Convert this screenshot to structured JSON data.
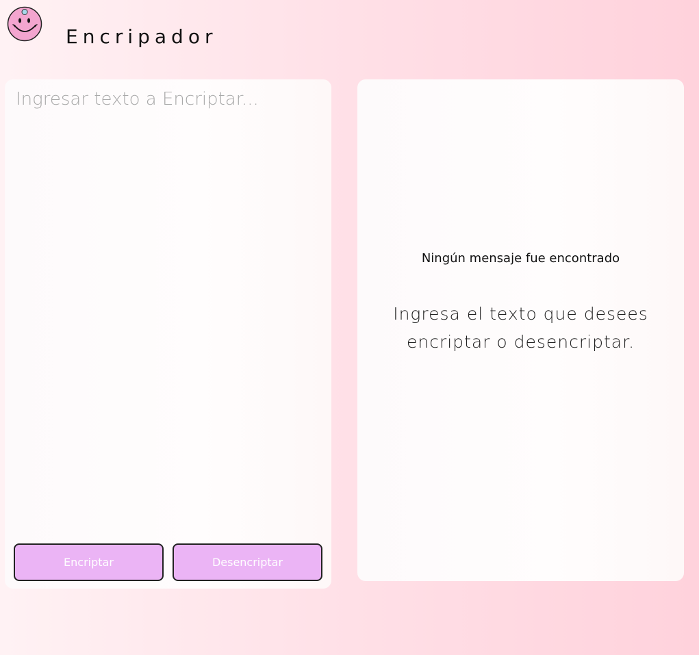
{
  "header": {
    "title": "Encripador",
    "logo_icon": "smiley-face-icon"
  },
  "input_panel": {
    "placeholder": "Ingresar texto a Encriptar...",
    "value": "",
    "encrypt_label": "Encriptar",
    "decrypt_label": "Desencriptar"
  },
  "output_panel": {
    "title": "Ningún mensaje fue encontrado",
    "description": "Ingresa el texto que desees encriptar o desencriptar."
  },
  "colors": {
    "button_bg": "#ebb4f5",
    "logo_face": "#f3a5cf",
    "background_start": "#fff2f4",
    "background_end": "#ffd2dc"
  }
}
